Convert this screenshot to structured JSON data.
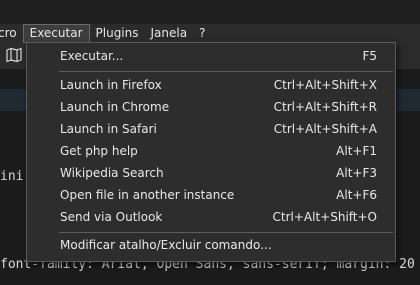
{
  "menubar": {
    "items": [
      {
        "label": "cro"
      },
      {
        "label": "Executar",
        "active": true
      },
      {
        "label": "Plugins"
      },
      {
        "label": "Janela"
      },
      {
        "label": "?"
      }
    ]
  },
  "toolbar": {
    "icon": "map-icon"
  },
  "editor": {
    "line1": "ini",
    "line2": "font-family: Arial, Open Sans, sans-serif; margin: 20"
  },
  "menu": {
    "items": [
      {
        "label": "Executar...",
        "shortcut": "F5"
      },
      {
        "label": "Launch in Firefox",
        "shortcut": "Ctrl+Alt+Shift+X"
      },
      {
        "label": "Launch in Chrome",
        "shortcut": "Ctrl+Alt+Shift+R"
      },
      {
        "label": "Launch in Safari",
        "shortcut": "Ctrl+Alt+Shift+A"
      },
      {
        "label": "Get php help",
        "shortcut": "Alt+F1"
      },
      {
        "label": "Wikipedia Search",
        "shortcut": "Alt+F3"
      },
      {
        "label": "Open file in another instance",
        "shortcut": "Alt+F6"
      },
      {
        "label": "Send via Outlook",
        "shortcut": "Ctrl+Alt+Shift+O"
      },
      {
        "label": "Modificar atalho/Excluir comando...",
        "shortcut": ""
      }
    ]
  },
  "colors": {
    "background": "#1e1e1e",
    "menu_background": "#2d2d2d",
    "menu_border": "#5a5a5a",
    "text": "#e8e8e8"
  }
}
